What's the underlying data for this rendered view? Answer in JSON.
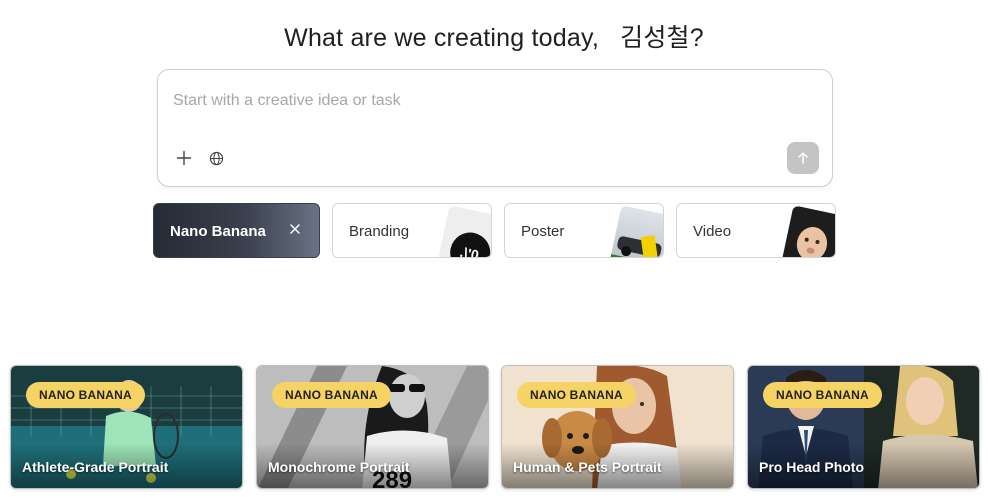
{
  "header": {
    "greeting": "What are we creating today,",
    "user_name": "김성철",
    "suffix": "?"
  },
  "prompt": {
    "placeholder": "Start with a creative idea or task"
  },
  "chips": [
    {
      "label": "Nano Banana",
      "active": true
    },
    {
      "label": "Branding"
    },
    {
      "label": "Poster"
    },
    {
      "label": "Video"
    }
  ],
  "cards": [
    {
      "badge": "NANO BANANA",
      "title": "Athlete-Grade Portrait"
    },
    {
      "badge": "NANO BANANA",
      "title": "Monochrome Portrait"
    },
    {
      "badge": "NANO BANANA",
      "title": "Human & Pets Portrait"
    },
    {
      "badge": "NANO BANANA",
      "title": "Pro Head Photo"
    }
  ],
  "colors": {
    "badge": "#f5d364",
    "send_button": "#c4c4c4",
    "active_chip": "#262a35"
  },
  "icons": [
    "plus-icon",
    "globe-icon",
    "arrow-up-icon",
    "close-icon"
  ]
}
